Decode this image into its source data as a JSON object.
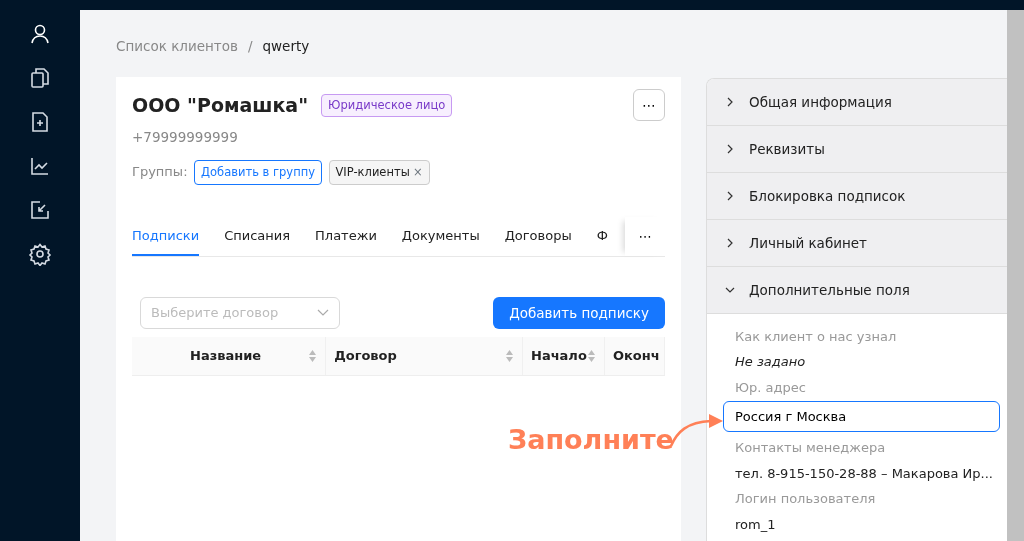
{
  "sidebar": {
    "items": [
      {
        "selected": true
      },
      {
        "selected": false
      },
      {
        "selected": false
      },
      {
        "selected": false
      },
      {
        "selected": false
      },
      {
        "selected": false
      }
    ]
  },
  "breadcrumb": {
    "parent": "Список клиентов",
    "separator": "/",
    "current": "qwerty"
  },
  "client": {
    "name": "ООО \"Ромашка\"",
    "type_badge": "Юридическое лицо",
    "phone": "+79999999999",
    "groups_label": "Группы:",
    "add_group_button": "Добавить в группу",
    "groups": [
      {
        "label": "VIP-клиенты",
        "remove": "×"
      }
    ],
    "more_button": "⋯"
  },
  "tabs": [
    {
      "label": "Подписки",
      "selected": true
    },
    {
      "label": "Списания",
      "selected": false
    },
    {
      "label": "Платежи",
      "selected": false
    },
    {
      "label": "Документы",
      "selected": false
    },
    {
      "label": "Договоры",
      "selected": false
    },
    {
      "label": "Ф",
      "selected": false
    }
  ],
  "tabs_more": "⋯",
  "contract_select": {
    "placeholder": "Выберите договор"
  },
  "add_subscription_button": "Добавить подписку",
  "table": {
    "columns": [
      {
        "label": "Название",
        "sortable": true
      },
      {
        "label": "Договор",
        "sortable": true
      },
      {
        "label": "Начало",
        "sortable": true
      },
      {
        "label": "Оконч",
        "sortable": false
      }
    ]
  },
  "accordion": [
    {
      "title": "Общая информация",
      "expanded": false
    },
    {
      "title": "Реквизиты",
      "expanded": false
    },
    {
      "title": "Блокировка подписок",
      "expanded": false
    },
    {
      "title": "Личный кабинет",
      "expanded": false
    },
    {
      "title": "Дополнительные поля",
      "expanded": true
    }
  ],
  "extra_fields": [
    {
      "label": "Как клиент о нас узнал",
      "value": "Не задано",
      "kind": "empty"
    },
    {
      "label": "Юр. адрес",
      "value": "Россия г Москва",
      "kind": "input"
    },
    {
      "label": "Контакты менеджера",
      "value": "тел. 8-915-150-28-88 – Макарова Ир...",
      "kind": "text"
    },
    {
      "label": "Логин пользователя",
      "value": "rom_1",
      "kind": "text"
    }
  ],
  "annotation": {
    "text": "Заполните"
  }
}
